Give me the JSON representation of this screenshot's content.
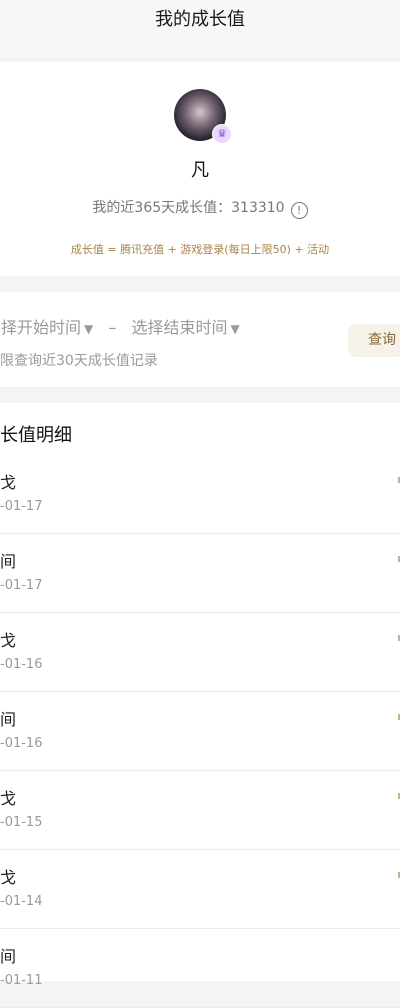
{
  "header": {
    "title": "我的成长值"
  },
  "profile": {
    "username": "凡",
    "badge_icon": "vip-badge-icon",
    "growth_label": "我的近365天成长值：313310",
    "formula": "成长值 = 腾讯充值 + 游戏登录(每日上限50) + 活动"
  },
  "filter": {
    "start_placeholder": "择开始时间",
    "separator": "–",
    "end_placeholder": "选择结束时间",
    "note": "限查询近30天成长值记录",
    "query_label": "查询"
  },
  "details": {
    "title": "长值明细",
    "items": [
      {
        "title": "戈",
        "date": "-01-17"
      },
      {
        "title": "间",
        "date": "-01-17"
      },
      {
        "title": "戈",
        "date": "-01-16"
      },
      {
        "title": "间",
        "date": "-01-16"
      },
      {
        "title": "戈",
        "date": "-01-15"
      },
      {
        "title": "戈",
        "date": "-01-14"
      },
      {
        "title": "间",
        "date": "-01-11"
      }
    ]
  },
  "colors": {
    "accent_gold": "#a8844a",
    "page_bg": "#f4f4f6"
  }
}
